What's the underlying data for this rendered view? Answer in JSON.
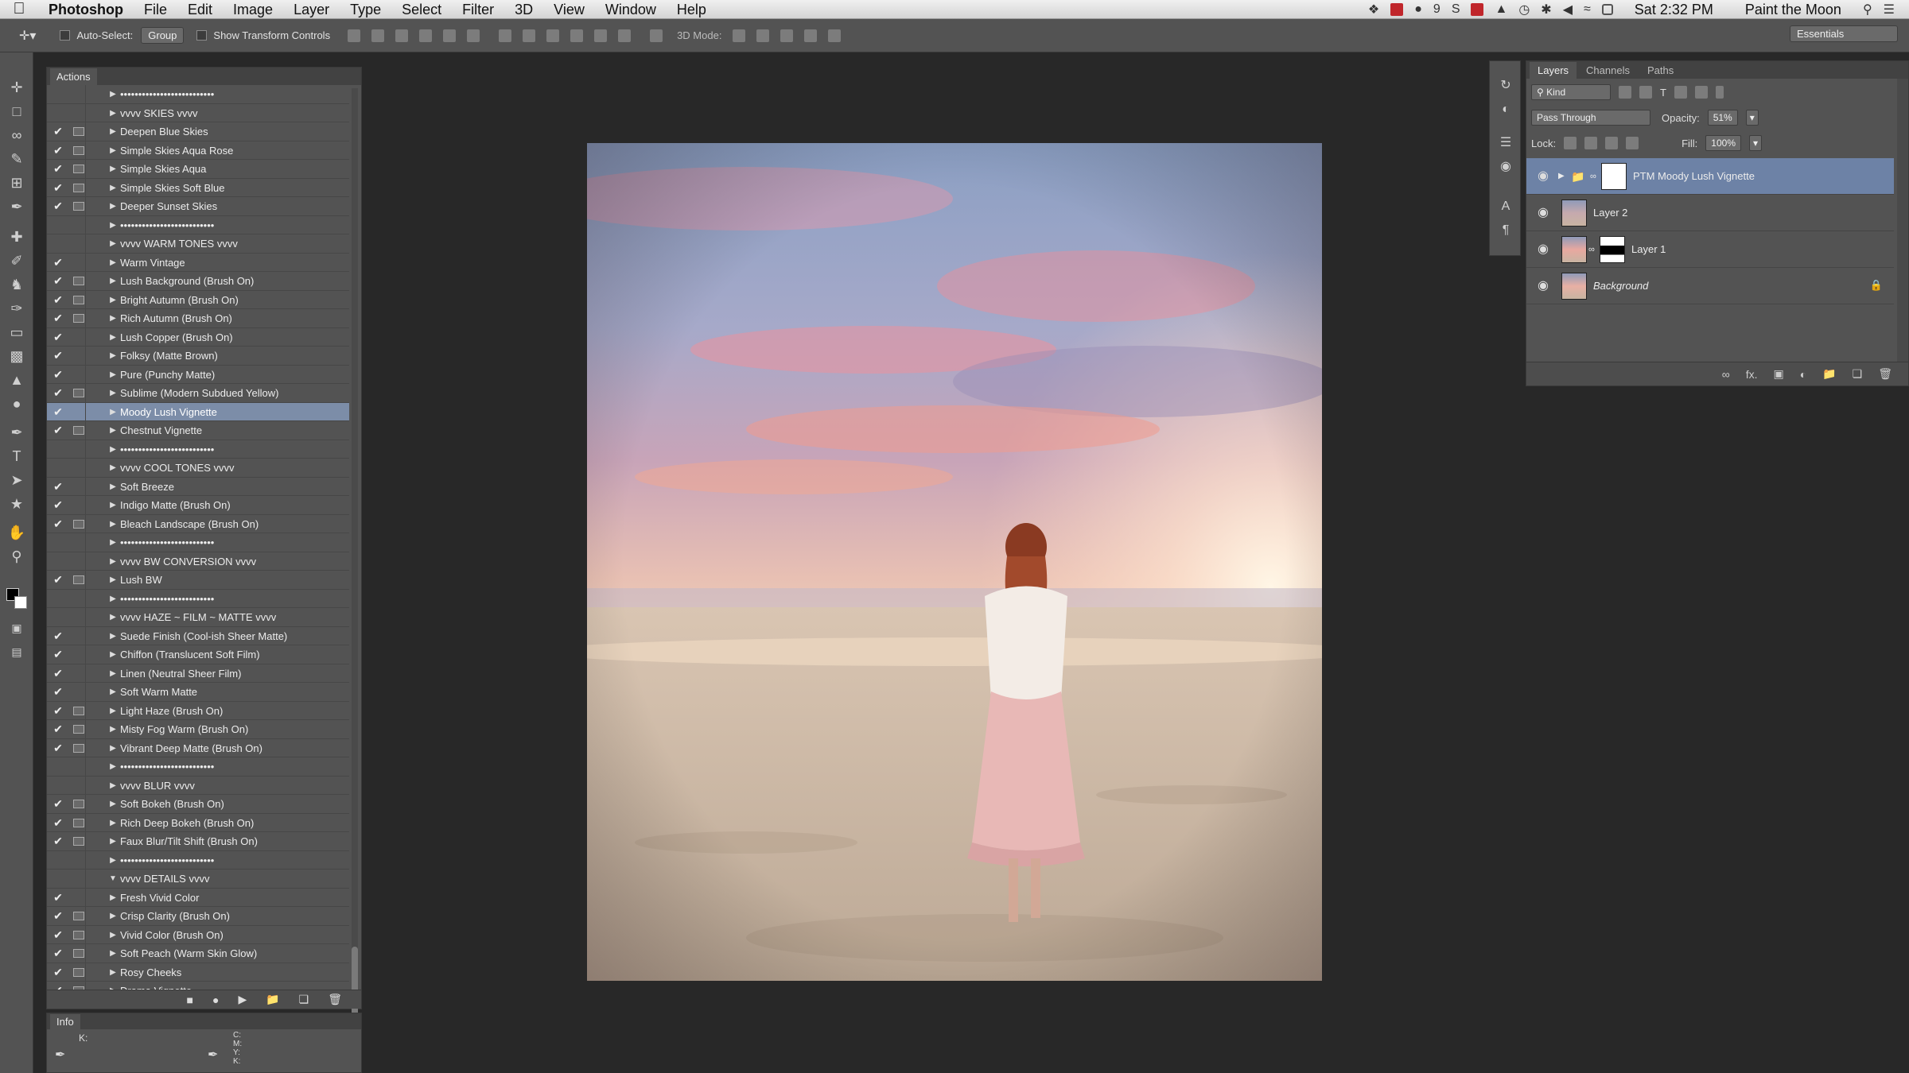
{
  "menubar": {
    "app": "Photoshop",
    "items": [
      "File",
      "Edit",
      "Image",
      "Layer",
      "Type",
      "Select",
      "Filter",
      "3D",
      "View",
      "Window",
      "Help"
    ],
    "badge_count": "9",
    "clock": "Sat 2:32 PM",
    "user": "Paint the Moon"
  },
  "options_bar": {
    "auto_select_label": "Auto-Select:",
    "auto_select_value": "Group",
    "show_transform_label": "Show Transform Controls",
    "mode_3d_label": "3D Mode:",
    "workspace": "Essentials"
  },
  "actions_panel": {
    "tab": "Actions",
    "items": [
      {
        "name": "••••••••••••••••••••••••••",
        "check": false,
        "dialog": false,
        "expanded": false
      },
      {
        "name": "vvvv  SKIES  vvvv",
        "check": false,
        "dialog": false,
        "expanded": false
      },
      {
        "name": "Deepen Blue Skies",
        "check": true,
        "dialog": true,
        "expanded": false
      },
      {
        "name": "Simple Skies Aqua Rose",
        "check": true,
        "dialog": true,
        "expanded": false
      },
      {
        "name": "Simple Skies Aqua",
        "check": true,
        "dialog": true,
        "expanded": false
      },
      {
        "name": "Simple Skies Soft Blue",
        "check": true,
        "dialog": true,
        "expanded": false
      },
      {
        "name": "Deeper Sunset Skies",
        "check": true,
        "dialog": true,
        "expanded": false
      },
      {
        "name": "••••••••••••••••••••••••••",
        "check": false,
        "dialog": false,
        "expanded": false
      },
      {
        "name": "vvvv  WARM TONES  vvvv",
        "check": false,
        "dialog": false,
        "expanded": false
      },
      {
        "name": "Warm Vintage",
        "check": true,
        "dialog": false,
        "expanded": false
      },
      {
        "name": "Lush Background (Brush On)",
        "check": true,
        "dialog": true,
        "expanded": false
      },
      {
        "name": "Bright Autumn (Brush On)",
        "check": true,
        "dialog": true,
        "expanded": false
      },
      {
        "name": "Rich Autumn (Brush On)",
        "check": true,
        "dialog": true,
        "expanded": false
      },
      {
        "name": "Lush Copper (Brush On)",
        "check": true,
        "dialog": false,
        "expanded": false
      },
      {
        "name": "Folksy (Matte Brown)",
        "check": true,
        "dialog": false,
        "expanded": false
      },
      {
        "name": "Pure (Punchy Matte)",
        "check": true,
        "dialog": false,
        "expanded": false
      },
      {
        "name": "Sublime (Modern Subdued Yellow)",
        "check": true,
        "dialog": true,
        "expanded": false
      },
      {
        "name": "Moody Lush Vignette",
        "check": true,
        "dialog": false,
        "expanded": false,
        "selected": true
      },
      {
        "name": "Chestnut Vignette",
        "check": true,
        "dialog": true,
        "expanded": false
      },
      {
        "name": "••••••••••••••••••••••••••",
        "check": false,
        "dialog": false,
        "expanded": false
      },
      {
        "name": "vvvv  COOL TONES  vvvv",
        "check": false,
        "dialog": false,
        "expanded": false
      },
      {
        "name": "Soft Breeze",
        "check": true,
        "dialog": false,
        "expanded": false
      },
      {
        "name": "Indigo Matte (Brush On)",
        "check": true,
        "dialog": false,
        "expanded": false
      },
      {
        "name": "Bleach Landscape (Brush On)",
        "check": true,
        "dialog": true,
        "expanded": false
      },
      {
        "name": "••••••••••••••••••••••••••",
        "check": false,
        "dialog": false,
        "expanded": false
      },
      {
        "name": "vvvv  BW CONVERSION  vvvv",
        "check": false,
        "dialog": false,
        "expanded": false
      },
      {
        "name": "Lush BW",
        "check": true,
        "dialog": true,
        "expanded": false
      },
      {
        "name": "••••••••••••••••••••••••••",
        "check": false,
        "dialog": false,
        "expanded": false
      },
      {
        "name": "vvvv  HAZE ~ FILM ~ MATTE vvvv",
        "check": false,
        "dialog": false,
        "expanded": false
      },
      {
        "name": "Suede Finish (Cool-ish Sheer Matte)",
        "check": true,
        "dialog": false,
        "expanded": false
      },
      {
        "name": "Chiffon (Translucent Soft Film)",
        "check": true,
        "dialog": false,
        "expanded": false
      },
      {
        "name": "Linen (Neutral Sheer Film)",
        "check": true,
        "dialog": false,
        "expanded": false
      },
      {
        "name": "Soft Warm Matte",
        "check": true,
        "dialog": false,
        "expanded": false
      },
      {
        "name": "Light Haze (Brush On)",
        "check": true,
        "dialog": true,
        "expanded": false
      },
      {
        "name": "Misty Fog Warm (Brush On)",
        "check": true,
        "dialog": true,
        "expanded": false
      },
      {
        "name": "Vibrant Deep Matte (Brush On)",
        "check": true,
        "dialog": true,
        "expanded": false
      },
      {
        "name": "••••••••••••••••••••••••••",
        "check": false,
        "dialog": false,
        "expanded": false
      },
      {
        "name": "vvvv  BLUR vvvv",
        "check": false,
        "dialog": false,
        "expanded": false
      },
      {
        "name": "Soft Bokeh (Brush On)",
        "check": true,
        "dialog": true,
        "expanded": false
      },
      {
        "name": "Rich Deep Bokeh (Brush On)",
        "check": true,
        "dialog": true,
        "expanded": false
      },
      {
        "name": "Faux Blur/Tilt Shift (Brush On)",
        "check": true,
        "dialog": true,
        "expanded": false
      },
      {
        "name": "••••••••••••••••••••••••••",
        "check": false,
        "dialog": false,
        "expanded": false
      },
      {
        "name": "vvvv  DETAILS vvvv",
        "check": false,
        "dialog": false,
        "expanded": true
      },
      {
        "name": "Fresh Vivid Color",
        "check": true,
        "dialog": false,
        "expanded": false
      },
      {
        "name": "Crisp Clarity (Brush On)",
        "check": true,
        "dialog": true,
        "expanded": false
      },
      {
        "name": "Vivid Color (Brush On)",
        "check": true,
        "dialog": true,
        "expanded": false
      },
      {
        "name": "Soft Peach (Warm Skin Glow)",
        "check": true,
        "dialog": true,
        "expanded": false
      },
      {
        "name": "Rosy Cheeks",
        "check": true,
        "dialog": true,
        "expanded": false
      },
      {
        "name": "Drama Vignette",
        "check": true,
        "dialog": true,
        "expanded": false
      }
    ]
  },
  "info_panel": {
    "tab": "Info",
    "k_label": "K:",
    "cmyk_labels": "C:\nM:\nY:\nK:"
  },
  "layers_panel": {
    "tabs": [
      "Layers",
      "Channels",
      "Paths"
    ],
    "filter_kind": "Kind",
    "blend_mode": "Pass Through",
    "opacity_label": "Opacity:",
    "opacity_value": "51%",
    "lock_label": "Lock:",
    "fill_label": "Fill:",
    "fill_value": "100%",
    "layers": [
      {
        "name": "PTM Moody Lush Vignette",
        "kind": "group",
        "selected": true
      },
      {
        "name": "Layer 2",
        "kind": "pixel",
        "selected": false
      },
      {
        "name": "Layer 1",
        "kind": "pixel-mask",
        "selected": false
      },
      {
        "name": "Background",
        "kind": "background",
        "selected": false
      }
    ]
  },
  "colors": {
    "panel": "#535353",
    "canvas_bg": "#282828",
    "selection": "#7c8da8"
  }
}
